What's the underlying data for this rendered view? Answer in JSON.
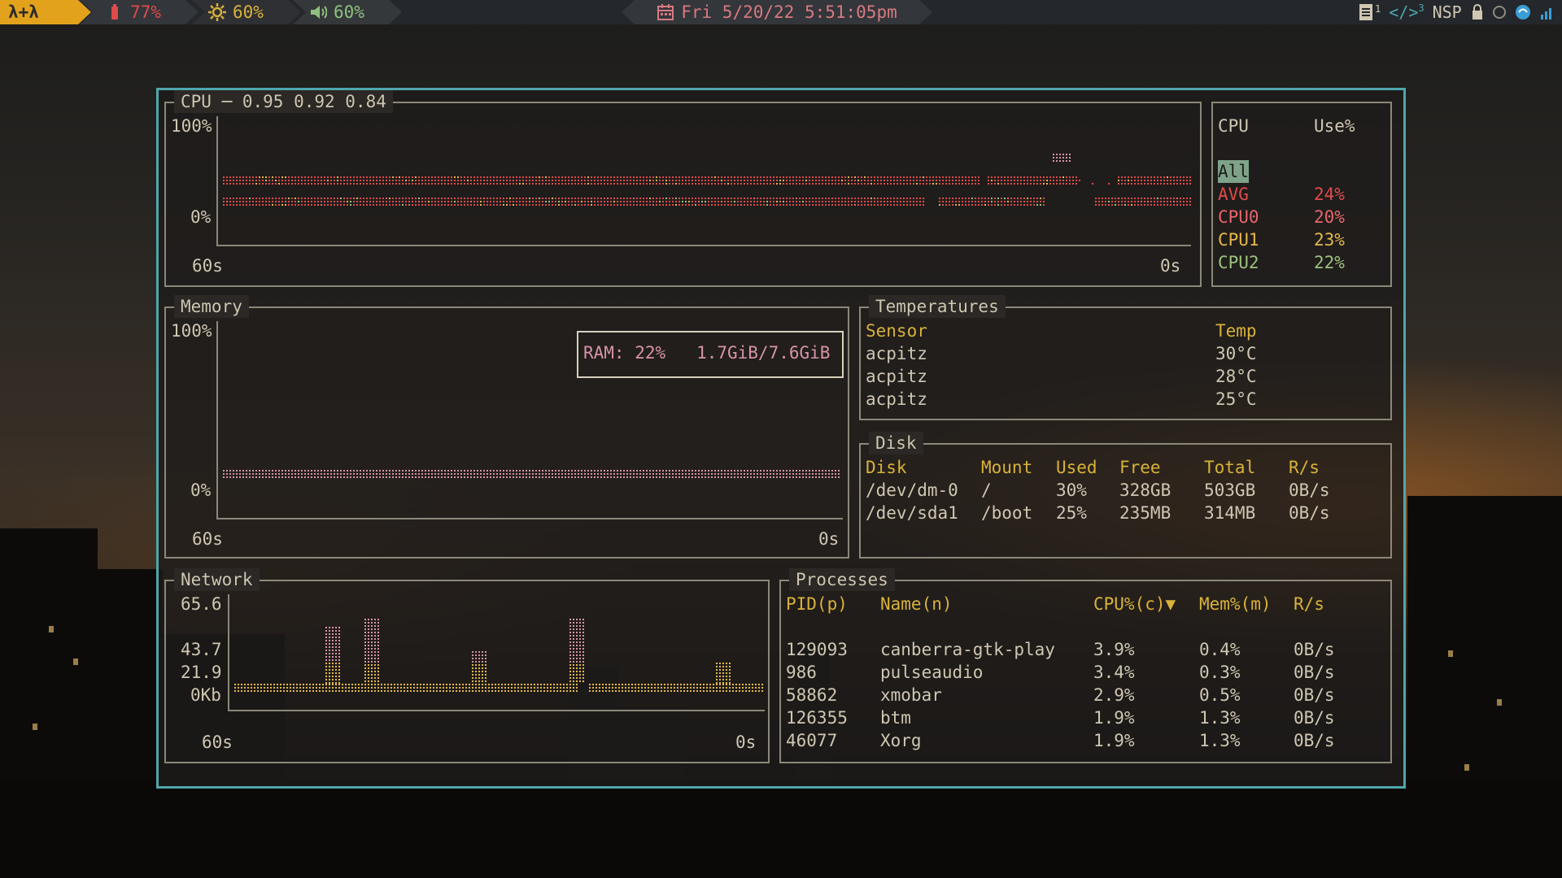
{
  "topbar": {
    "logo": "λ+λ",
    "battery": "77%",
    "brightness": "60%",
    "volume": "60%",
    "datetime": "Fri 5/20/22 5:51:05pm",
    "workspace_1": "1",
    "workspace_3": "3",
    "nsp": "NSP"
  },
  "cpu": {
    "title": "CPU ─ 0.95 0.92 0.84",
    "y_max": "100%",
    "y_min": "0%",
    "x_start": "60s",
    "x_end": "0s",
    "legend_header_cpu": "CPU",
    "legend_header_use": "Use%",
    "selected": "All",
    "rows": [
      {
        "name": "AVG",
        "use": "24%",
        "color": "#e04a4a"
      },
      {
        "name": "CPU0",
        "use": "20%",
        "color": "#e8666a"
      },
      {
        "name": "CPU1",
        "use": "23%",
        "color": "#e6b84a"
      },
      {
        "name": "CPU2",
        "use": "22%",
        "color": "#9cc27c"
      }
    ]
  },
  "memory": {
    "title": "Memory",
    "y_max": "100%",
    "y_min": "0%",
    "x_start": "60s",
    "x_end": "0s",
    "ram_label": "RAM: 22%   1.7GiB/7.6GiB",
    "ram_fraction": 0.22
  },
  "temperatures": {
    "title": "Temperatures",
    "header_sensor": "Sensor",
    "header_temp": "Temp",
    "rows": [
      {
        "sensor": "acpitz",
        "temp": "30°C"
      },
      {
        "sensor": "acpitz",
        "temp": "28°C"
      },
      {
        "sensor": "acpitz",
        "temp": "25°C"
      }
    ]
  },
  "disk": {
    "title": "Disk",
    "headers": [
      "Disk",
      "Mount",
      "Used",
      "Free",
      "Total",
      "R/s"
    ],
    "rows": [
      [
        "/dev/dm-0",
        "/",
        "30%",
        "328GB",
        "503GB",
        "0B/s"
      ],
      [
        "/dev/sda1",
        "/boot",
        "25%",
        "235MB",
        "314MB",
        "0B/s"
      ]
    ]
  },
  "network": {
    "title": "Network",
    "y_labels": [
      "65.6",
      "43.7",
      "21.9",
      "0Kb"
    ],
    "x_start": "60s",
    "x_end": "0s"
  },
  "processes": {
    "title": "Processes",
    "headers": [
      "PID(p)",
      "Name(n)",
      "CPU%(c)▼",
      "Mem%(m)",
      "R/s"
    ],
    "rows": [
      [
        "129093",
        "canberra-gtk-play",
        "3.9%",
        "0.4%",
        "0B/s"
      ],
      [
        "986",
        "pulseaudio",
        "3.4%",
        "0.3%",
        "0B/s"
      ],
      [
        "58862",
        "xmobar",
        "2.9%",
        "0.5%",
        "0B/s"
      ],
      [
        "126355",
        "btm",
        "1.9%",
        "1.3%",
        "0B/s"
      ],
      [
        "46077",
        "Xorg",
        "1.9%",
        "1.3%",
        "0B/s"
      ]
    ]
  }
}
